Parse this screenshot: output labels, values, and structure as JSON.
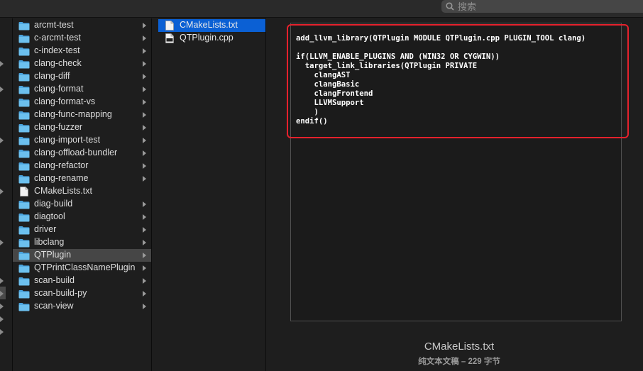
{
  "search": {
    "placeholder": "搜索"
  },
  "columns": {
    "folder_list": [
      {
        "label": "arcmt-test",
        "kind": "folder"
      },
      {
        "label": "c-arcmt-test",
        "kind": "folder"
      },
      {
        "label": "c-index-test",
        "kind": "folder"
      },
      {
        "label": "clang-check",
        "kind": "folder"
      },
      {
        "label": "clang-diff",
        "kind": "folder"
      },
      {
        "label": "clang-format",
        "kind": "folder"
      },
      {
        "label": "clang-format-vs",
        "kind": "folder"
      },
      {
        "label": "clang-func-mapping",
        "kind": "folder"
      },
      {
        "label": "clang-fuzzer",
        "kind": "folder"
      },
      {
        "label": "clang-import-test",
        "kind": "folder"
      },
      {
        "label": "clang-offload-bundler",
        "kind": "folder"
      },
      {
        "label": "clang-refactor",
        "kind": "folder"
      },
      {
        "label": "clang-rename",
        "kind": "folder"
      },
      {
        "label": "CMakeLists.txt",
        "kind": "file"
      },
      {
        "label": "diag-build",
        "kind": "folder"
      },
      {
        "label": "diagtool",
        "kind": "folder"
      },
      {
        "label": "driver",
        "kind": "folder"
      },
      {
        "label": "libclang",
        "kind": "folder"
      },
      {
        "label": "QTPlugin",
        "kind": "folder",
        "selected": true
      },
      {
        "label": "QTPrintClassNamePlugin",
        "kind": "folder"
      },
      {
        "label": "scan-build",
        "kind": "folder"
      },
      {
        "label": "scan-build-py",
        "kind": "folder"
      },
      {
        "label": "scan-view",
        "kind": "folder"
      }
    ],
    "file_list": [
      {
        "label": "CMakeLists.txt",
        "kind": "file",
        "active": true
      },
      {
        "label": "QTPlugin.cpp",
        "kind": "cpp"
      }
    ]
  },
  "preview": {
    "code": "add_llvm_library(QTPlugin MODULE QTPlugin.cpp PLUGIN_TOOL clang)\n\nif(LLVM_ENABLE_PLUGINS AND (WIN32 OR CYGWIN))\n  target_link_libraries(QTPlugin PRIVATE\n    clangAST\n    clangBasic\n    clangFrontend\n    LLVMSupport\n    )\nendif()",
    "file_name": "CMakeLists.txt",
    "file_info": "纯文本文稿 – 229 字节"
  },
  "colors": {
    "selection_blue": "#0b60d4",
    "highlight_red": "#e5212c",
    "folder_blue": "#5ab4e8"
  }
}
